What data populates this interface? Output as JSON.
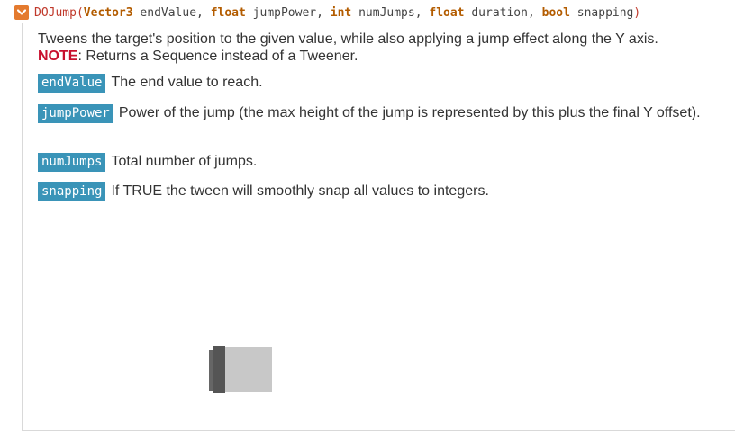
{
  "method": {
    "name": "DOJump",
    "open_paren": "(",
    "close_paren": ")",
    "params": [
      {
        "type": "Vector3",
        "name": "endValue",
        "sep": ", "
      },
      {
        "type": "float",
        "name": "jumpPower",
        "sep": ", "
      },
      {
        "type": "int",
        "name": "numJumps",
        "sep": ", "
      },
      {
        "type": "float",
        "name": "duration",
        "sep": ", "
      },
      {
        "type": "bool",
        "name": "snapping",
        "sep": ""
      }
    ],
    "description": "Tweens the target's position to the given value, while also applying a jump effect along the Y axis.",
    "note_label": "NOTE",
    "note_text": ": Returns a Sequence instead of a Tweener."
  },
  "parameters": [
    {
      "name": "endValue",
      "text": "The end value to reach."
    },
    {
      "name": "jumpPower",
      "text": "Power of the jump (the max height of the jump is represented by this plus the final Y offset)."
    },
    {
      "name": "numJumps",
      "text": "Total number of jumps."
    },
    {
      "name": "snapping",
      "text": "If TRUE the tween will smoothly snap all values to integers."
    }
  ],
  "icons": {
    "toggle": "collapse-chevron-icon"
  },
  "colors": {
    "toggle_bg": "#e47a2e",
    "method_name": "#c0392b",
    "keyword": "#b35c00",
    "param_badge": "#3a94b8",
    "note": "#c8102e"
  }
}
